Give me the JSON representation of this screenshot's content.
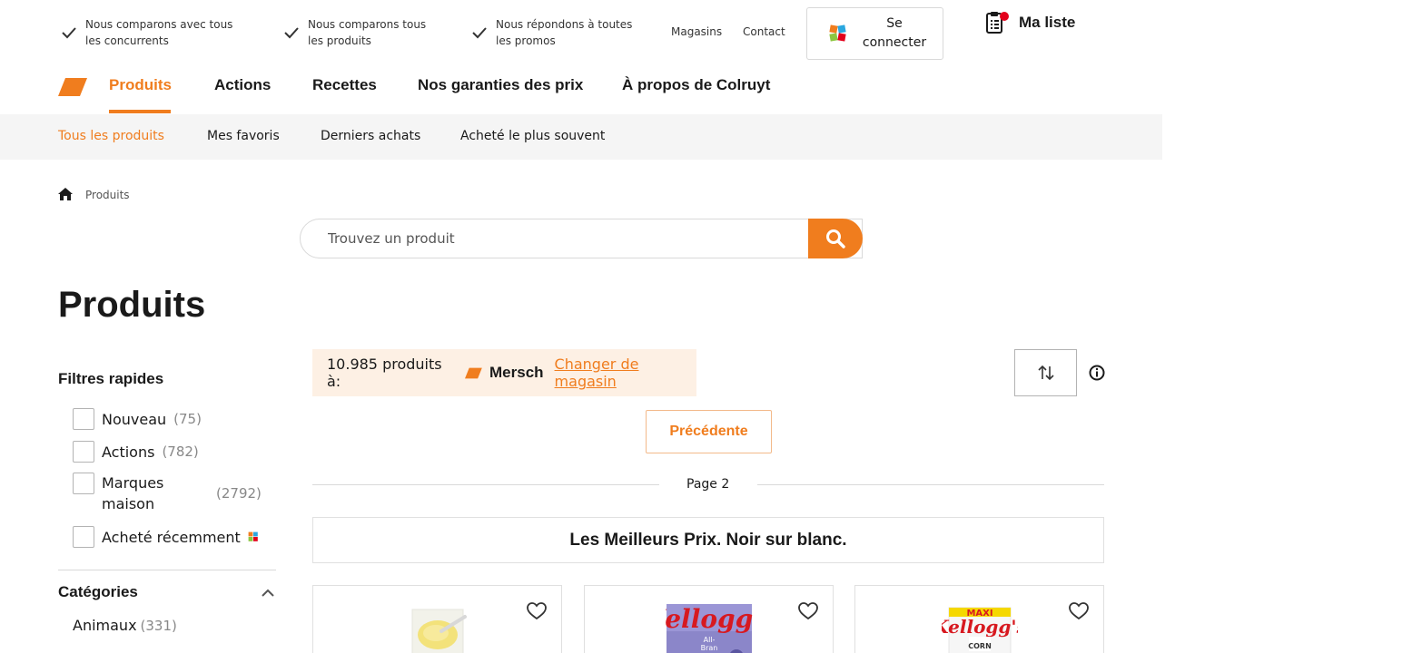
{
  "usp": [
    {
      "line1": "Nous comparons avec tous",
      "line2": "les concurrents"
    },
    {
      "line1": "Nous comparons tous",
      "line2": "les produits"
    },
    {
      "line1": "Nous répondons à toutes",
      "line2": "les promos"
    }
  ],
  "toplinks": {
    "stores": "Magasins",
    "contact": "Contact"
  },
  "login": {
    "line1": "Se",
    "line2": "connecter"
  },
  "mylist": {
    "label": "Ma liste"
  },
  "mainnav": [
    "Produits",
    "Actions",
    "Recettes",
    "Nos garanties des prix",
    "À propos de Colruyt"
  ],
  "subnav": [
    "Tous les produits",
    "Mes favoris",
    "Derniers achats",
    "Acheté le plus souvent"
  ],
  "breadcrumb": {
    "current": "Produits"
  },
  "search": {
    "placeholder": "Trouvez un produit"
  },
  "page_title": "Produits",
  "quick_filters": {
    "title": "Filtres rapides",
    "items": [
      {
        "label": "Nouveau",
        "count": "(75)"
      },
      {
        "label": "Actions",
        "count": "(782)"
      },
      {
        "label": "Marques maison",
        "count": "(2792)"
      },
      {
        "label": "Acheté récemment",
        "count": ""
      }
    ]
  },
  "categories": {
    "title": "Catégories",
    "items": [
      {
        "label": "Animaux",
        "count": "(331)"
      }
    ]
  },
  "results": {
    "count_text": "10.985 produits à:",
    "store": "Mersch",
    "change_store": "Changer de magasin",
    "prev": "Précédente",
    "page": "Page 2",
    "banner": "Les Meilleurs Prix. Noir sur blanc."
  },
  "colors": {
    "accent": "#f07d1e",
    "subnav_bg": "#f5f5f5",
    "store_bg": "#fdf0e4"
  },
  "products": [
    {
      "image": "custard-dessert"
    },
    {
      "image": "kelloggs-all-bran-box",
      "brand": "Kellogg's"
    },
    {
      "image": "kelloggs-corn-flakes-maxi-box",
      "brand": "Kellogg's"
    }
  ]
}
